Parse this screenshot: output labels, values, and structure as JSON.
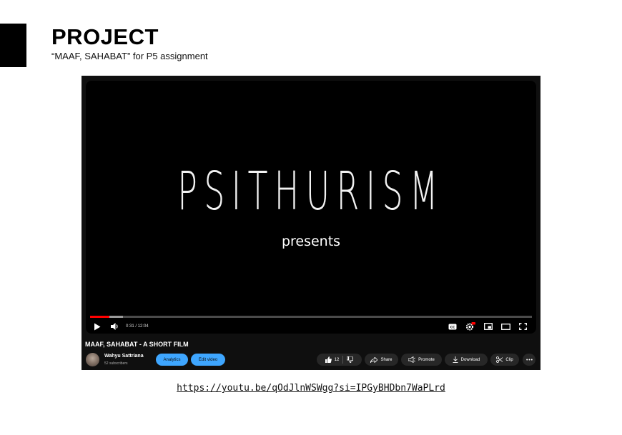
{
  "header": {
    "title": "PROJECT",
    "subtitle": "“MAAF, SAHABAT” for P5 assignment"
  },
  "video": {
    "brand_text": "PSITHURISM",
    "presents_text": "presents",
    "progress_fraction": 0.043,
    "buffered_fraction": 0.075,
    "time": "0:31 / 12:04",
    "title": "MAAF, SAHABAT - A SHORT FILM",
    "channel": {
      "name": "Wahyu Sattriana",
      "subscribers": "52 subscribers"
    },
    "buttons": {
      "analytics": "Analytics",
      "edit_video": "Edit video",
      "likes": "12",
      "share": "Share",
      "promote": "Promote",
      "download": "Download",
      "clip": "Clip"
    },
    "icons": [
      "play-icon",
      "volume-icon",
      "captions-icon",
      "settings-icon",
      "miniplayer-icon",
      "theater-icon",
      "fullscreen-icon",
      "like-icon",
      "dislike-icon",
      "share-icon",
      "promote-icon",
      "download-icon",
      "clip-icon",
      "more-icon"
    ],
    "colors": {
      "progress": "#ff0000",
      "accent_button": "#3ea6ff",
      "hd_badge": "#ff0000"
    }
  },
  "link": "https://youtu.be/qOdJlnWSWgg?si=IPGyBHDbn7WaPLrd"
}
